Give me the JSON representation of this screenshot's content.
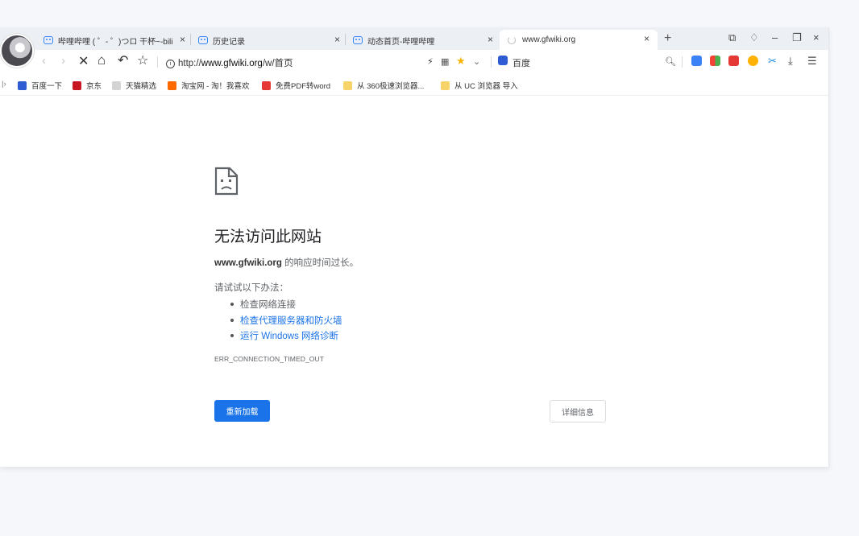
{
  "tabs": [
    {
      "label": "哔哩哔哩 ( ゜- ゜)つロ 干杯~-bili",
      "close": "×"
    },
    {
      "label": "历史记录",
      "close": "×"
    },
    {
      "label": "动态首页-哔哩哔哩",
      "close": "×"
    },
    {
      "label": "www.gfwiki.org",
      "close": "×",
      "loading": true
    }
  ],
  "window_controls": {
    "new_tab": "+",
    "restore_tabs": "⧉",
    "skin": "♢",
    "minimize": "–",
    "maximize": "❐",
    "close": "×"
  },
  "toolbar": {
    "back": "‹",
    "forward": "›",
    "stop": "✕",
    "home": "⌂",
    "undo": "↶",
    "favorite": "☆",
    "address_prefix": "http://",
    "address_host": "www.gfwiki.org",
    "address_path": "/w/首页",
    "search_engine": "百度",
    "menu": "☰"
  },
  "bookmarks": [
    {
      "label": "百度一下",
      "icon": "paw-icon",
      "color": "#2f5bd3"
    },
    {
      "label": "京东",
      "icon": "jd-icon",
      "color": "#c81623"
    },
    {
      "label": "天猫精选",
      "icon": "tmall-icon",
      "color": "#d3d3d3"
    },
    {
      "label": "淘宝网 - 淘！我喜欢",
      "icon": "taobao-icon",
      "color": "#ff6a00"
    },
    {
      "label": "免费PDF转word",
      "icon": "pdf-icon",
      "color": "#e53935"
    },
    {
      "label": "从 360极速浏览器...",
      "icon": "folder-icon",
      "color": "#f7d46b"
    },
    {
      "label": "从 UC 浏览器 导入",
      "icon": "folder-icon",
      "color": "#f7d46b"
    }
  ],
  "error_page": {
    "title": "无法访问此网站",
    "host": "www.gfwiki.org",
    "message": " 的响应时间过长。",
    "try_label": "请试试以下办法：",
    "suggestions": [
      {
        "text": "检查网络连接",
        "link": false
      },
      {
        "text": "检查代理服务器和防火墙",
        "link": true
      },
      {
        "text": "运行 Windows 网络诊断",
        "link": true
      }
    ],
    "error_code": "ERR_CONNECTION_TIMED_OUT",
    "reload_label": "重新加载",
    "details_label": "详细信息"
  },
  "colors": {
    "accent": "#1a73e8",
    "tab_icon": "#2f86ff"
  }
}
